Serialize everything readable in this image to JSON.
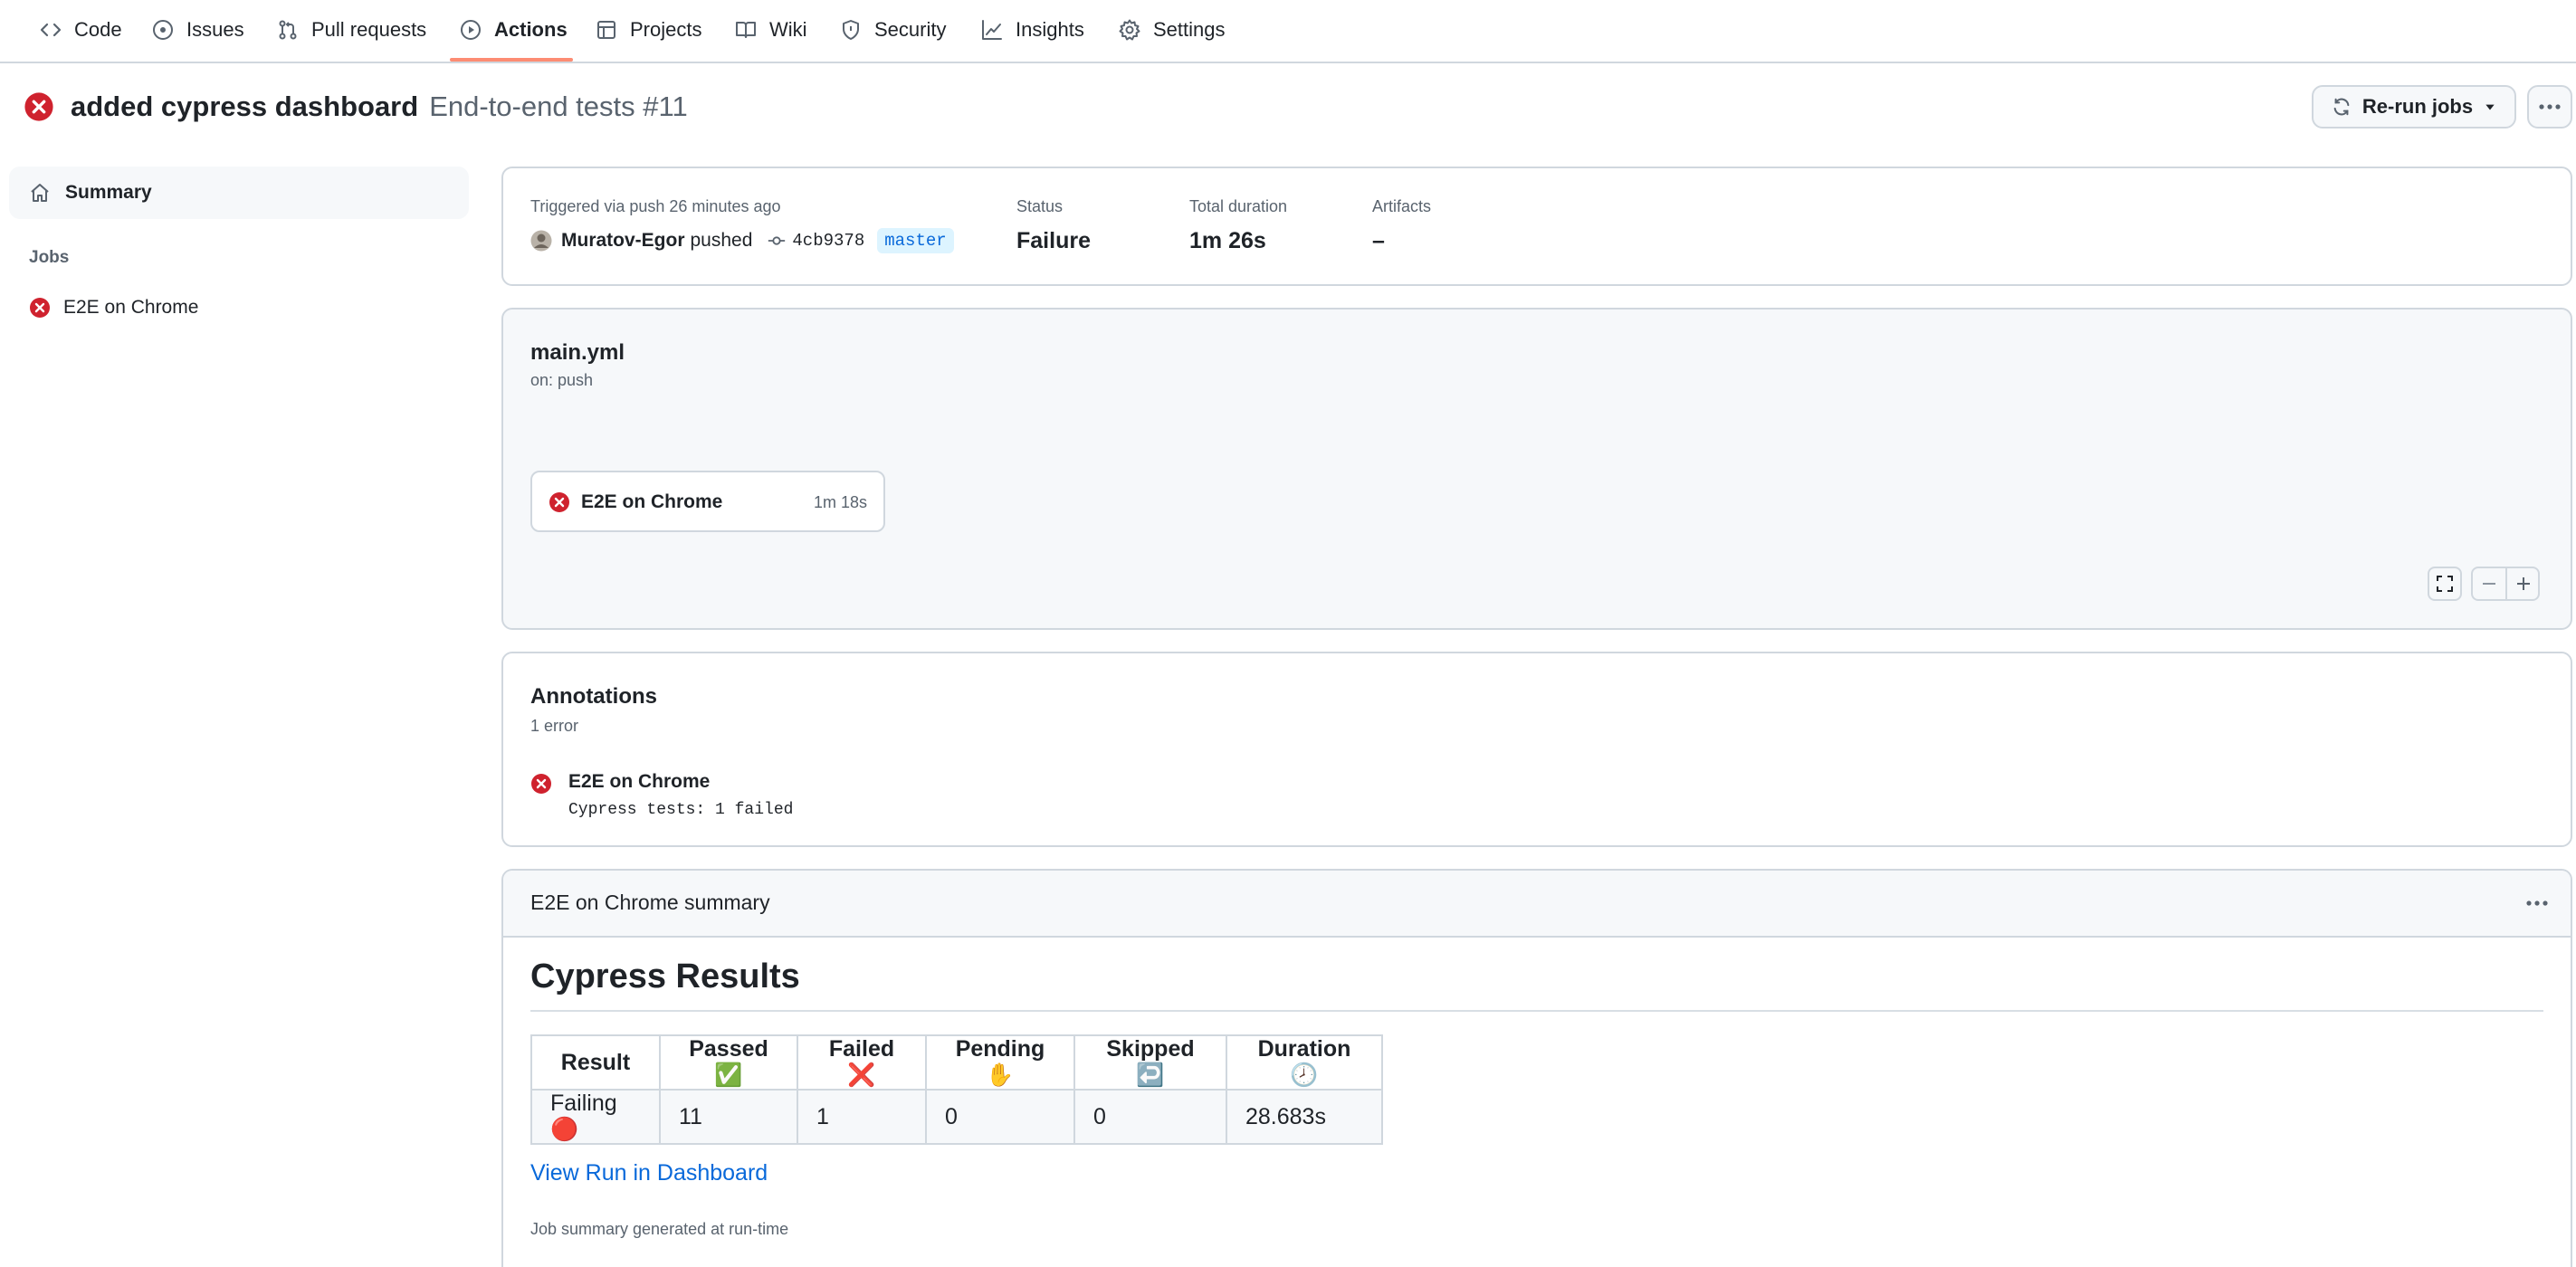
{
  "nav": {
    "items": [
      {
        "label": "Code",
        "icon": "code-icon"
      },
      {
        "label": "Issues",
        "icon": "issue-icon"
      },
      {
        "label": "Pull requests",
        "icon": "pull-request-icon"
      },
      {
        "label": "Actions",
        "icon": "play-icon"
      },
      {
        "label": "Projects",
        "icon": "table-icon"
      },
      {
        "label": "Wiki",
        "icon": "book-icon"
      },
      {
        "label": "Security",
        "icon": "shield-icon"
      },
      {
        "label": "Insights",
        "icon": "graph-icon"
      },
      {
        "label": "Settings",
        "icon": "gear-icon"
      }
    ],
    "active": "Actions"
  },
  "header": {
    "title": "added cypress dashboard",
    "workflow": "End-to-end tests #11",
    "rerun_label": "Re-run jobs",
    "status_icon": "x-circle-fill-icon"
  },
  "sidebar": {
    "summary_label": "Summary",
    "jobs_heading": "Jobs",
    "jobs": [
      {
        "label": "E2E on Chrome",
        "status": "failure"
      }
    ]
  },
  "run_info": {
    "triggered": "Triggered via push 26 minutes ago",
    "actor": "Muratov-Egor",
    "action": "pushed",
    "commit": "4cb9378",
    "branch": "master",
    "status_label": "Status",
    "status_value": "Failure",
    "duration_label": "Total duration",
    "duration_value": "1m 26s",
    "artifacts_label": "Artifacts",
    "artifacts_value": "–"
  },
  "workflow": {
    "file": "main.yml",
    "trigger": "on: push",
    "job_name": "E2E on Chrome",
    "job_duration": "1m 18s"
  },
  "annotations": {
    "title": "Annotations",
    "count": "1 error",
    "item_title": "E2E on Chrome",
    "item_message": "Cypress tests: 1 failed"
  },
  "summary": {
    "header": "E2E on Chrome summary",
    "heading": "Cypress Results",
    "columns": [
      "Result",
      "Passed ✅",
      "Failed ❌",
      "Pending ✋",
      "Skipped ↩️",
      "Duration 🕗"
    ],
    "row": [
      "Failing 🔴",
      "11",
      "1",
      "0",
      "0",
      "28.683s"
    ],
    "link": "View Run in Dashboard",
    "footer": "Job summary generated at run-time"
  },
  "colors": {
    "danger": "#cf222e",
    "accent_link": "#0969da",
    "nav_underline": "#fd8c73",
    "border": "#d0d7de",
    "muted_text": "#59636e"
  }
}
